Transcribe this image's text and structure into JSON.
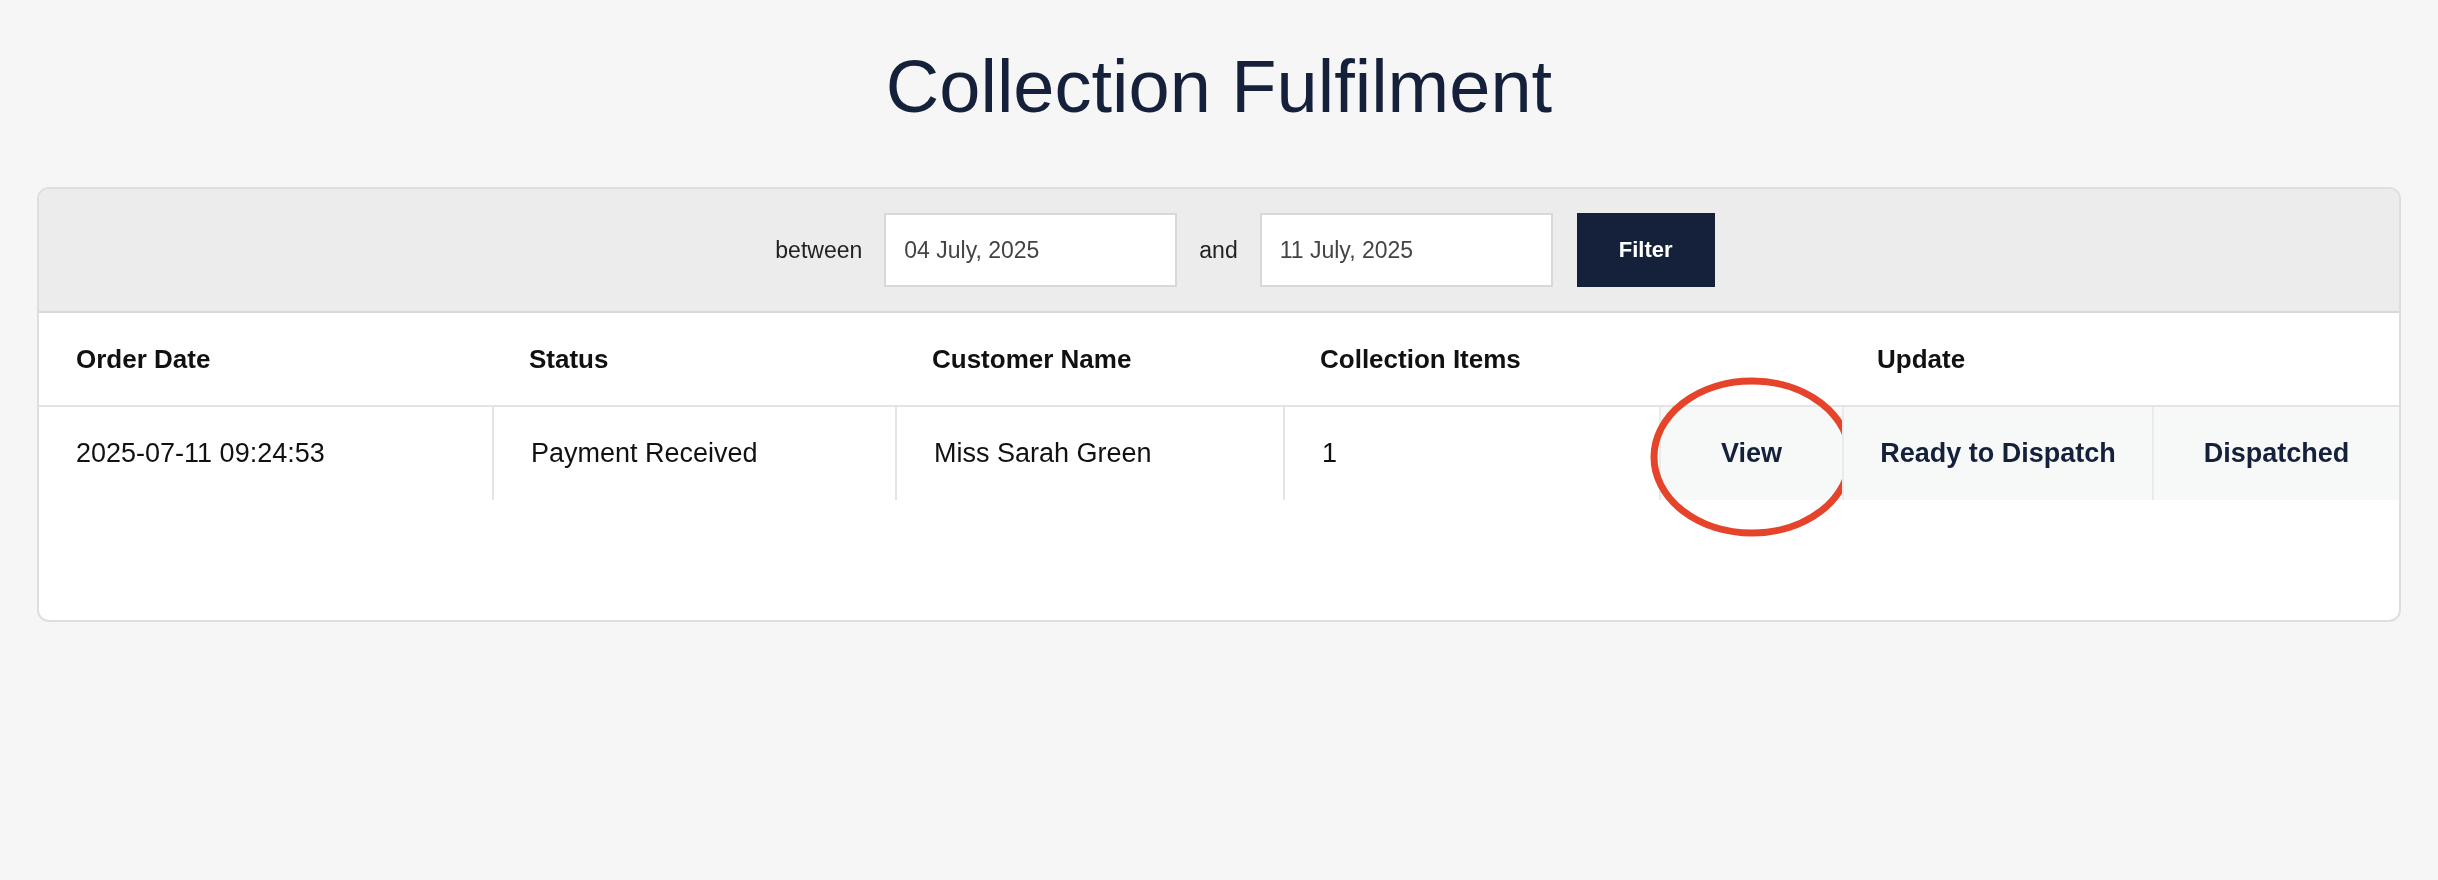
{
  "title": "Collection Fulfilment",
  "filter": {
    "from_label": "between",
    "from_value": "04 July, 2025",
    "to_label": "and",
    "to_value": "11 July, 2025",
    "button": "Filter"
  },
  "table": {
    "columns": [
      "Order Date",
      "Status",
      "Customer Name",
      "Collection Items"
    ],
    "update_column": "Update",
    "rows": [
      {
        "cells": [
          "2025-07-11 09:24:53",
          "Payment Received",
          "Miss Sarah Green",
          "1"
        ],
        "actions": [
          {
            "label": "View",
            "circled": true
          },
          {
            "label": "Ready to Dispatch",
            "circled": false
          },
          {
            "label": "Dispatched",
            "circled": false
          }
        ]
      }
    ]
  }
}
